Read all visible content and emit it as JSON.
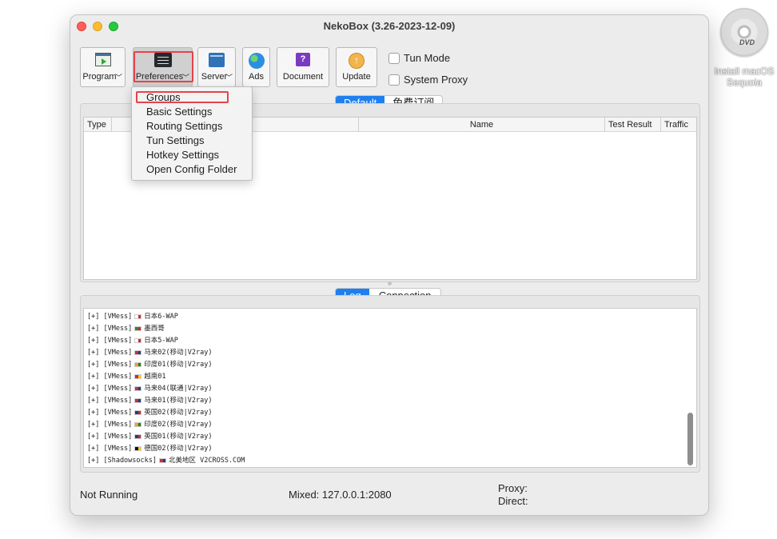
{
  "desktop": {
    "dvd_text": "DVD",
    "icon_label_line1": "Install macOS",
    "icon_label_line2": "Sequoia"
  },
  "window": {
    "title": "NekoBox (3.26-2023-12-09)"
  },
  "toolbar": {
    "program": "Program",
    "preferences": "Preferences",
    "server": "Server",
    "ads": "Ads",
    "document": "Document",
    "update": "Update",
    "doc_glyph": "?",
    "update_glyph": "↑"
  },
  "options": {
    "tun_mode": "Tun Mode",
    "system_proxy": "System Proxy"
  },
  "menu": {
    "items": [
      "Groups",
      "Basic Settings",
      "Routing Settings",
      "Tun Settings",
      "Hotkey Settings",
      "Open Config Folder"
    ]
  },
  "group_tabs": [
    "Default",
    "免费订阅"
  ],
  "table": {
    "columns": [
      "Type",
      "Name",
      "Test Result",
      "Traffic"
    ]
  },
  "log_tabs": [
    "Log",
    "Connection"
  ],
  "log_lines": [
    {
      "prefix": "[+] [VMess]",
      "flag_color": "#ffffff",
      "flag_dot": "#d8262f",
      "name": "日本6-WAP"
    },
    {
      "prefix": "[+] [VMess]",
      "flag_color": "#2e8b3a",
      "flag_dot": "#d8262f",
      "name": "墨西哥"
    },
    {
      "prefix": "[+] [VMess]",
      "flag_color": "#ffffff",
      "flag_dot": "#d8262f",
      "name": "日本5-WAP"
    },
    {
      "prefix": "[+] [VMess]",
      "flag_color": "#c8313d",
      "flag_dot": "#1d3c8f",
      "name": "马来02(移动|V2ray)"
    },
    {
      "prefix": "[+] [VMess]",
      "flag_color": "#ff9933",
      "flag_dot": "#138808",
      "name": "印度01(移动|V2ray)"
    },
    {
      "prefix": "[+] [VMess]",
      "flag_color": "#d8262f",
      "flag_dot": "#ffcd00",
      "name": "越南01"
    },
    {
      "prefix": "[+] [VMess]",
      "flag_color": "#c8313d",
      "flag_dot": "#1d3c8f",
      "name": "马来04(联通|V2ray)"
    },
    {
      "prefix": "[+] [VMess]",
      "flag_color": "#c8313d",
      "flag_dot": "#1d3c8f",
      "name": "马来01(移动|V2ray)"
    },
    {
      "prefix": "[+] [VMess]",
      "flag_color": "#1d3c8f",
      "flag_dot": "#d8262f",
      "name": "英国02(移动|V2ray)"
    },
    {
      "prefix": "[+] [VMess]",
      "flag_color": "#ff9933",
      "flag_dot": "#138808",
      "name": "印度02(移动|V2ray)"
    },
    {
      "prefix": "[+] [VMess]",
      "flag_color": "#1d3c8f",
      "flag_dot": "#d8262f",
      "name": "英国01(移动|V2ray)"
    },
    {
      "prefix": "[+] [VMess]",
      "flag_color": "#111111",
      "flag_dot": "#ffcd00",
      "name": "德国02(移动|V2ray)"
    },
    {
      "prefix": "[+] [Shadowsocks]",
      "flag_color": "#c8313d",
      "flag_dot": "#1d3c8f",
      "name": "北美地区 V2CROSS.COM"
    }
  ],
  "status": {
    "running": "Not Running",
    "mixed": "Mixed: 127.0.0.1:2080",
    "proxy": "Proxy:",
    "direct": "Direct:"
  }
}
